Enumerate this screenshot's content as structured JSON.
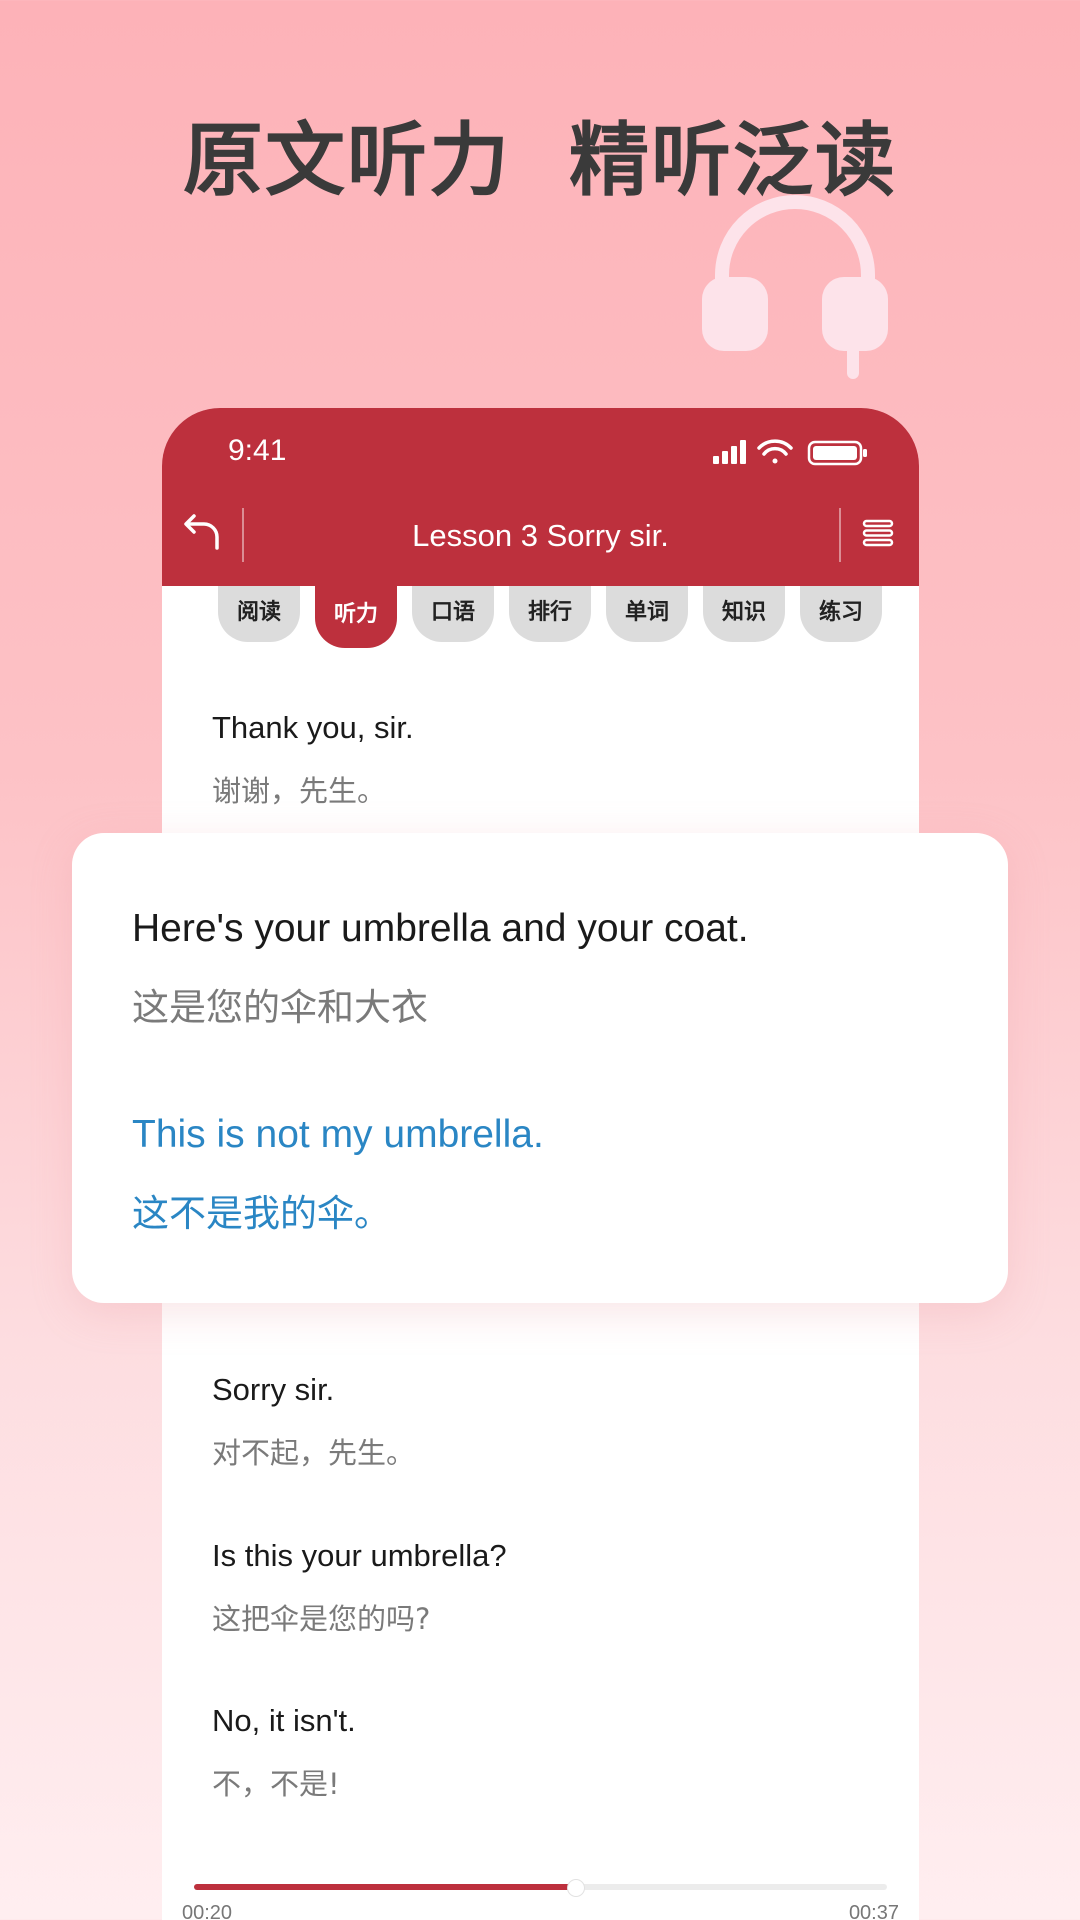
{
  "promo": {
    "title_left": "原文听力",
    "title_right": "精听泛读"
  },
  "status_bar": {
    "time": "9:41"
  },
  "header": {
    "title": "Lesson 3 Sorry sir."
  },
  "tabs": [
    {
      "label": "阅读",
      "active": false
    },
    {
      "label": "听力",
      "active": true
    },
    {
      "label": "口语",
      "active": false
    },
    {
      "label": "排行",
      "active": false
    },
    {
      "label": "单词",
      "active": false
    },
    {
      "label": "知识",
      "active": false
    },
    {
      "label": "练习",
      "active": false
    }
  ],
  "sentences_top": [
    {
      "en": "Thank you, sir.",
      "zh": "谢谢，先生。"
    }
  ],
  "card": {
    "sentences": [
      {
        "en": "Here's your umbrella and your coat.",
        "zh": "这是您的伞和大衣",
        "highlight": false
      },
      {
        "en": "This is not my umbrella.",
        "zh": "这不是我的伞。",
        "highlight": true
      }
    ]
  },
  "sentences_bottom": [
    {
      "en": "Sorry sir.",
      "zh": "对不起，先生。"
    },
    {
      "en": "Is this your umbrella?",
      "zh": "这把伞是您的吗?"
    },
    {
      "en": "No, it isn't.",
      "zh": "不，不是!"
    }
  ],
  "player": {
    "current_time": "00:20",
    "total_time": "00:37",
    "progress": 0.55
  },
  "colors": {
    "brand_red": "#bd303d",
    "highlight_blue": "#2a86c4"
  },
  "icons": {
    "back": "undo-arrow-icon",
    "menu": "hamburger-menu-icon",
    "decor": "headphones-icon"
  }
}
